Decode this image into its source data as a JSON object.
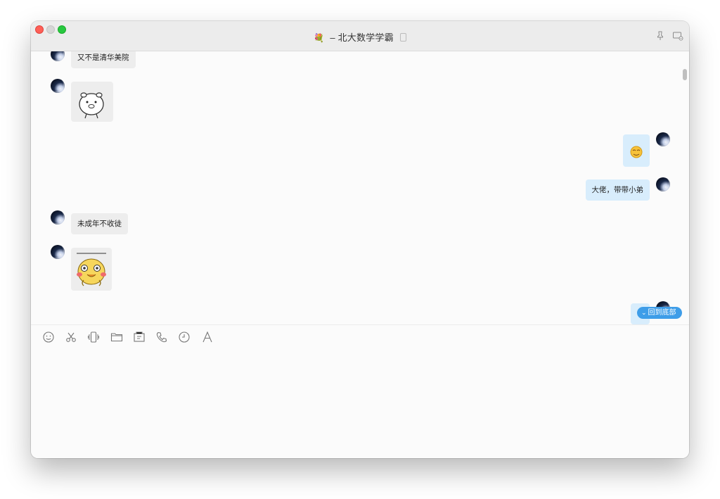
{
  "window": {
    "title": "北大数学学霸",
    "title_prefix_icon": "flower-emoji",
    "title_suffix_icon": "phone-device-icon"
  },
  "titlebar_actions": [
    {
      "name": "pin-icon"
    },
    {
      "name": "monitor-icon"
    }
  ],
  "messages": [
    {
      "side": "in",
      "type": "text",
      "text": "又不是清华美院"
    },
    {
      "side": "in",
      "type": "sticker",
      "sticker": "cartoon-pig-sticker"
    },
    {
      "side": "out",
      "type": "sticker",
      "sticker": "smiley-emoji"
    },
    {
      "side": "out",
      "type": "text",
      "text": "大佬，带带小弟"
    },
    {
      "side": "in",
      "type": "text",
      "text": "未成年不收徒"
    },
    {
      "side": "in",
      "type": "sticker",
      "sticker": "yellow-duck-sticker"
    },
    {
      "side": "out",
      "type": "sticker",
      "sticker": "partial-message"
    }
  ],
  "back_to_bottom": {
    "label": "回到底部"
  },
  "input_toolbar": [
    {
      "name": "emoji-icon"
    },
    {
      "name": "scissors-icon"
    },
    {
      "name": "shake-icon"
    },
    {
      "name": "folder-icon"
    },
    {
      "name": "screenshot-icon"
    },
    {
      "name": "phone-icon"
    },
    {
      "name": "history-icon"
    },
    {
      "name": "font-icon"
    }
  ],
  "colors": {
    "accent": "#3e9de8",
    "incoming_bubble": "#ededed",
    "outgoing_bubble": "#d8edfc"
  }
}
